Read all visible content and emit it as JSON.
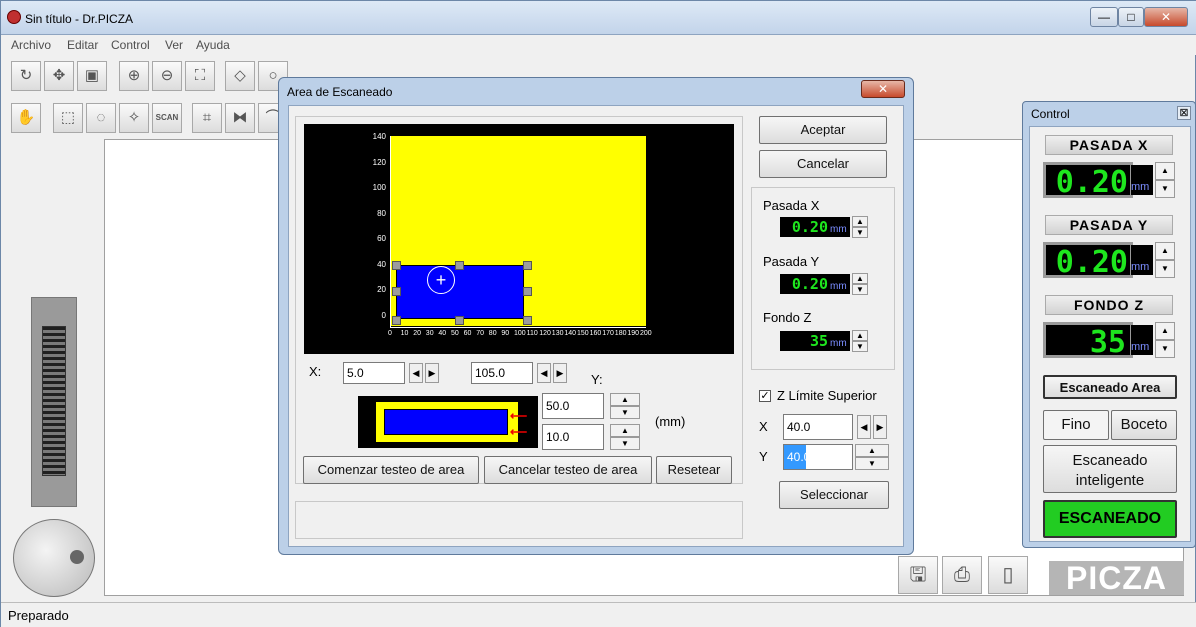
{
  "app": {
    "title": "Sin título - Dr.PICZA",
    "win_min": "—",
    "win_max": "□",
    "win_close": "✕"
  },
  "menu": [
    "Archivo",
    "Editar",
    "Control",
    "Ver",
    "Ayuda"
  ],
  "status": {
    "text": "Preparado"
  },
  "logo": {
    "text": "PICZA"
  },
  "dialog": {
    "title": "Area de Escaneado",
    "close": "✕",
    "buttons": {
      "accept": "Aceptar",
      "cancel": "Cancelar",
      "start_test": "Comenzar testeo de area",
      "cancel_test": "Cancelar testeo de area",
      "reset": "Resetear",
      "select": "Seleccionar"
    },
    "x_label": "X:",
    "y_label": "Y:",
    "x_start": "5.0",
    "x_end": "105.0",
    "y_top": "50.0",
    "y_bottom": "10.0",
    "unit": "(mm)",
    "pasada_x_label": "Pasada X",
    "pasada_x_value": "0.20",
    "pasada_y_label": "Pasada Y",
    "pasada_y_value": "0.20",
    "fondo_z_label": "Fondo Z",
    "fondo_z_value": "35",
    "mm": "mm",
    "z_limit_label": "Z Límite Superior",
    "z_limit_checked": true,
    "z_x_label": "X",
    "z_x_value": "40.0",
    "z_y_label": "Y",
    "z_y_value": "40.0",
    "y_ticks": [
      "140",
      "120",
      "100",
      "80",
      "60",
      "40",
      "20",
      "0"
    ],
    "x_ticks": [
      "0",
      "10",
      "20",
      "30",
      "40",
      "50",
      "60",
      "70",
      "80",
      "90",
      "100",
      "110",
      "120",
      "130",
      "140",
      "150",
      "160",
      "170",
      "180",
      "190",
      "200"
    ]
  },
  "control": {
    "title": "Control",
    "close": "⊠",
    "pasada_x_title": "PASADA X",
    "pasada_x_value": "0.20",
    "pasada_y_title": "PASADA Y",
    "pasada_y_value": "0.20",
    "fondo_z_title": "FONDO Z",
    "fondo_z_value": "35",
    "mm": "mm",
    "scan_area": "Escaneado Area",
    "fino": "Fino",
    "boceto": "Boceto",
    "smart": "Escaneado inteligente",
    "scan": "ESCANEADO"
  },
  "colors": {
    "yellow": "#ffff00",
    "blue": "#0000ff",
    "lcd_green": "#1ee61e",
    "scan_green": "#22cc22"
  }
}
